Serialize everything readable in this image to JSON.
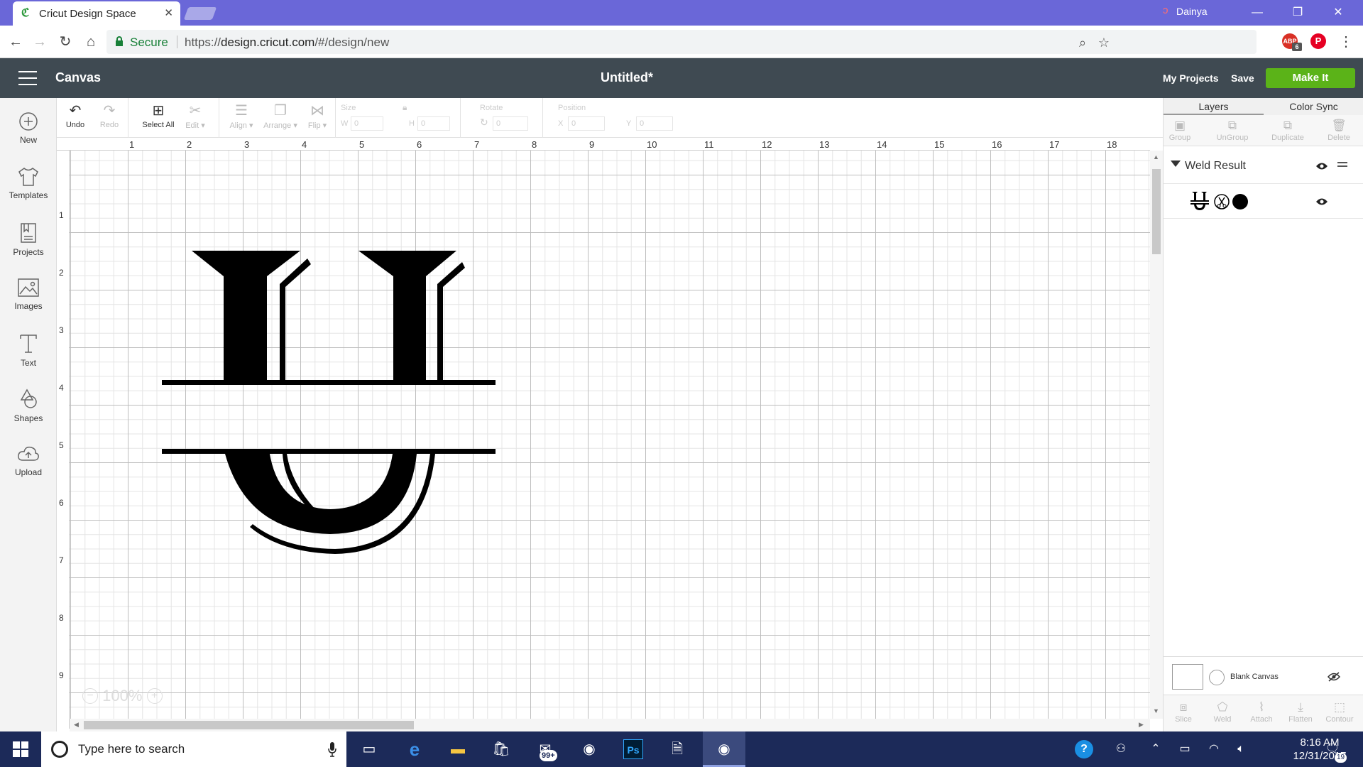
{
  "browser": {
    "tab_title": "Cricut Design Space",
    "user_name": "Dainya",
    "secure_label": "Secure",
    "url_scheme": "https://",
    "url_host": "design.cricut.com",
    "url_path": "/#/design/new",
    "extension_badge": "6"
  },
  "header": {
    "section": "Canvas",
    "doc_title": "Untitled*",
    "my_projects": "My Projects",
    "save": "Save",
    "make_it": "Make It"
  },
  "sidebar": {
    "items": [
      {
        "label": "New"
      },
      {
        "label": "Templates"
      },
      {
        "label": "Projects"
      },
      {
        "label": "Images"
      },
      {
        "label": "Text"
      },
      {
        "label": "Shapes"
      },
      {
        "label": "Upload"
      }
    ]
  },
  "toolbar": {
    "undo": "Undo",
    "redo": "Redo",
    "select_all": "Select All",
    "edit": "Edit",
    "align": "Align",
    "arrange": "Arrange",
    "flip": "Flip",
    "size_label": "Size",
    "w_label": "W",
    "h_label": "H",
    "w_value": "0",
    "h_value": "0",
    "rotate_label": "Rotate",
    "rotate_value": "0",
    "position_label": "Position",
    "x_label": "X",
    "y_label": "Y",
    "x_value": "0",
    "y_value": "0"
  },
  "ruler": {
    "top": [
      "1",
      "2",
      "3",
      "4",
      "5",
      "6",
      "7",
      "8",
      "9",
      "10",
      "11",
      "12",
      "13",
      "14",
      "15",
      "16",
      "17",
      "18"
    ],
    "left": [
      "1",
      "2",
      "3",
      "4",
      "5",
      "6",
      "7",
      "8",
      "9"
    ]
  },
  "zoom": {
    "level": "100%"
  },
  "panel": {
    "tabs": [
      "Layers",
      "Color Sync"
    ],
    "actions": [
      "Group",
      "UnGroup",
      "Duplicate",
      "Delete"
    ],
    "group_name": "Weld Result",
    "blank_canvas": "Blank Canvas",
    "bottom_actions": [
      "Slice",
      "Weld",
      "Attach",
      "Flatten",
      "Contour"
    ]
  },
  "taskbar": {
    "search_placeholder": "Type here to search",
    "mail_badge": "99+",
    "time": "8:16 AM",
    "date": "12/31/2017",
    "notif_count": "19"
  },
  "colors": {
    "tabbar": "#6a67d8",
    "header": "#3f4a52",
    "make_it": "#5bb318",
    "taskbar": "#1c2a59"
  }
}
